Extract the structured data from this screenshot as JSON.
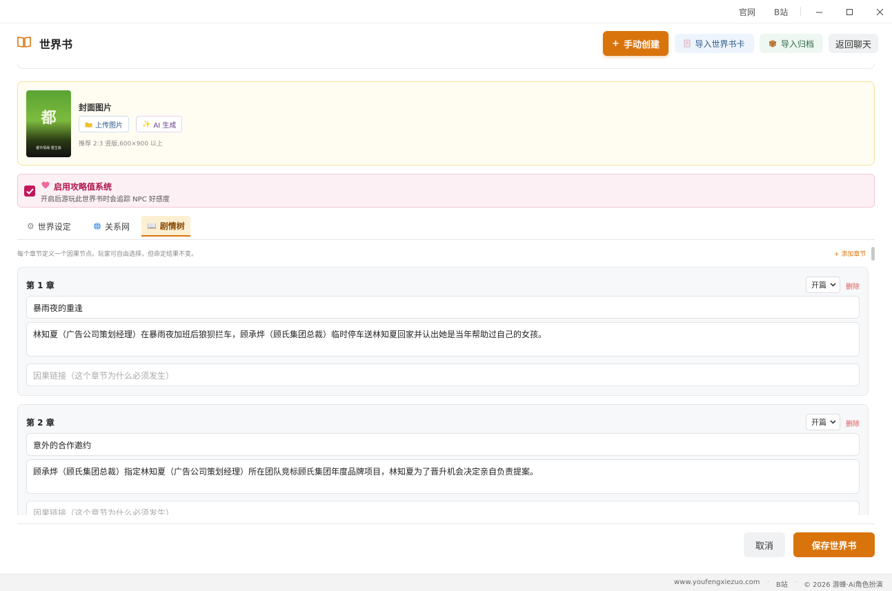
{
  "titlebar": {
    "official_site": "官网",
    "bilibili": "B站"
  },
  "header": {
    "title": "世界书",
    "manual_create": "手动创建",
    "import_card": "导入世界书卡",
    "import_archive": "导入归档",
    "back_chat": "返回聊天"
  },
  "cover": {
    "label": "封面图片",
    "upload": "上传图片",
    "ai_generate": "AI 生成",
    "hint": "推荐 2:3 竖版,600×900 以上",
    "image_char": "都",
    "image_sub": "都市情缘·重生篇"
  },
  "affinity": {
    "title": "启用攻略值系统",
    "desc": "开启后游玩此世界书时会追踪 NPC 好感度",
    "checked": true
  },
  "tabs": [
    {
      "label": "世界设定",
      "icon": "gear-icon"
    },
    {
      "label": "关系网",
      "icon": "globe-icon"
    },
    {
      "label": "剧情树",
      "icon": "book-icon",
      "active": true
    }
  ],
  "plot_tree": {
    "hint": "每个章节定义一个因果节点。玩家可自由选择，但命定结果不变。",
    "add_chapter": "+ 添加章节"
  },
  "chapters": [
    {
      "title": "第 1 章",
      "stage": "开篇",
      "delete": "删除",
      "name": "暴雨夜的重逢",
      "summary": "林知夏（广告公司策划经理）在暴雨夜加班后狼狈拦车，顾承烨（顾氏集团总裁）临时停车送林知夏回家并认出她是当年帮助过自己的女孩。",
      "causal_placeholder": "因果链接（这个章节为什么必须发生）"
    },
    {
      "title": "第 2 章",
      "stage": "开篇",
      "delete": "删除",
      "name": "意外的合作邀约",
      "summary": "顾承烨（顾氏集团总裁）指定林知夏（广告公司策划经理）所在团队竞标顾氏集团年度品牌项目，林知夏为了晋升机会决定亲自负责提案。",
      "causal_placeholder": "因果链接（这个章节为什么必须发生）"
    }
  ],
  "footer": {
    "cancel": "取消",
    "save": "保存世界书"
  },
  "statusbar": {
    "site": "www.youfengxiezuo.com",
    "bilibili": "B站",
    "copyright": "© 2026 游蜂·Ai角色扮演"
  },
  "colors": {
    "accent": "#d9740c",
    "pink": "#c2185b"
  }
}
